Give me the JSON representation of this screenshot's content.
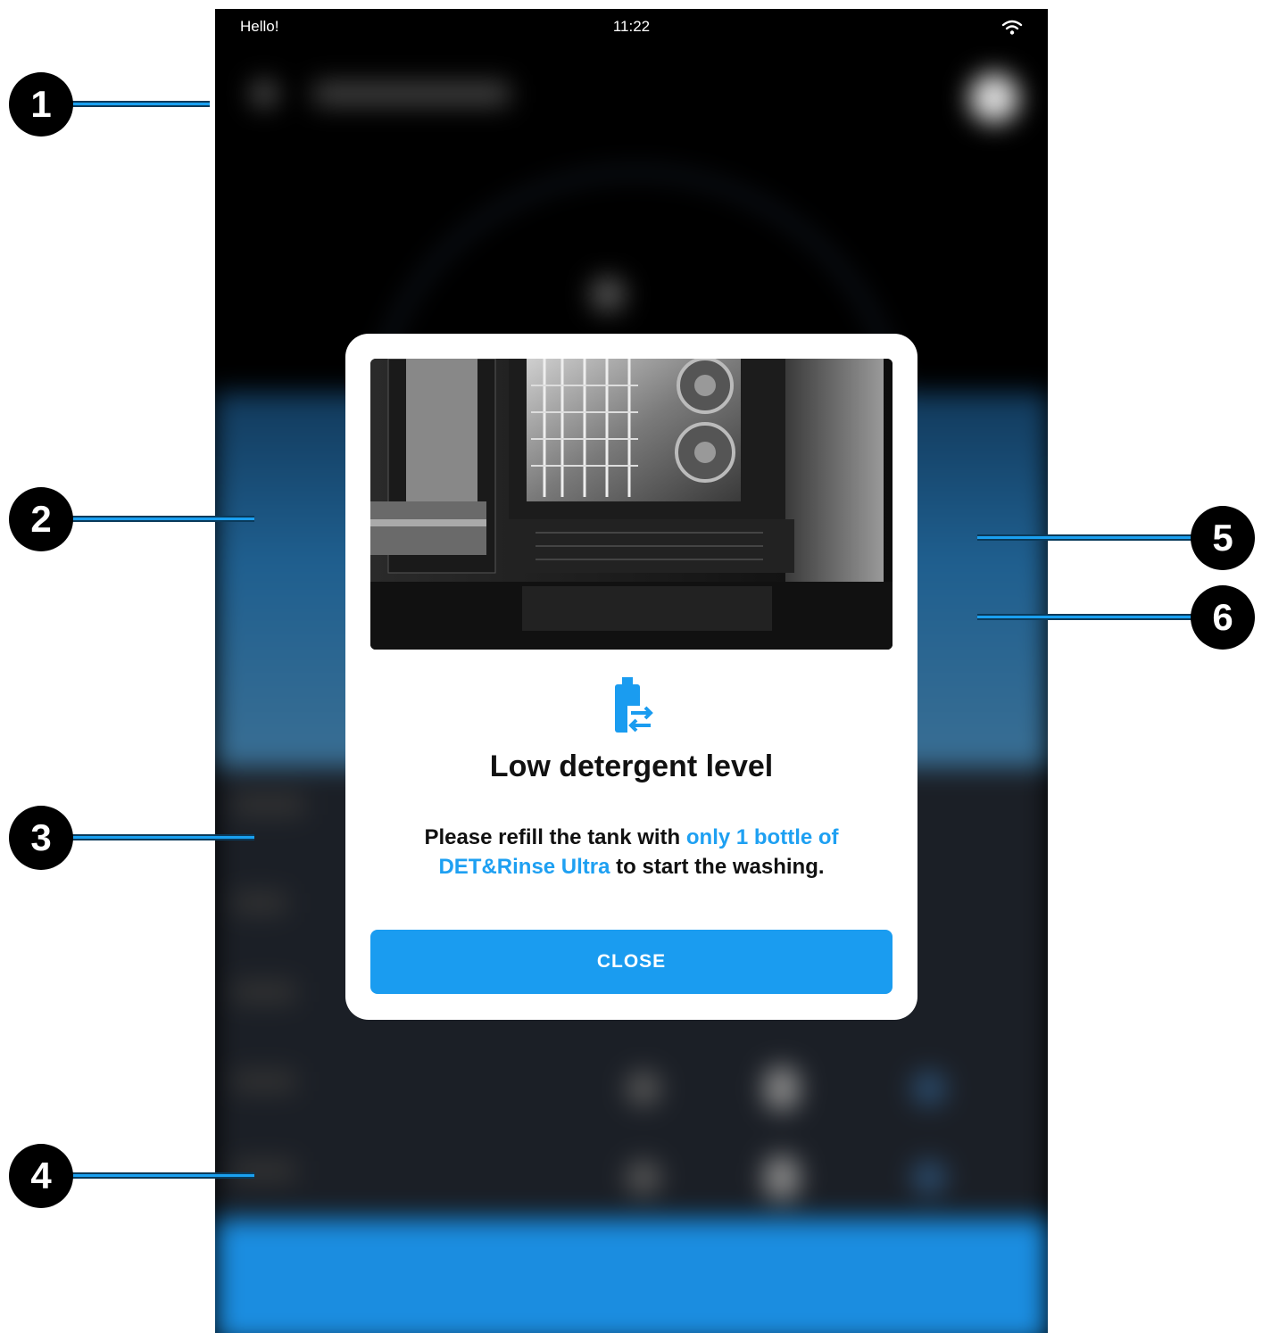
{
  "status_bar": {
    "greeting": "Hello!",
    "time": "11:22"
  },
  "modal": {
    "title": "Low detergent level",
    "message_part1": "Please refill the tank with ",
    "message_highlight": "only 1 bottle of DET&Rinse Ultra",
    "message_part2": " to start the washing.",
    "close_label": "CLOSE"
  },
  "callouts": [
    "1",
    "2",
    "3",
    "4",
    "5",
    "6"
  ],
  "colors": {
    "accent": "#1ea0f2",
    "button": "#1a9cf0",
    "callout_line": "#1aa0f0"
  },
  "icons": [
    "wifi-icon",
    "detergent-bottle-refill-icon"
  ]
}
